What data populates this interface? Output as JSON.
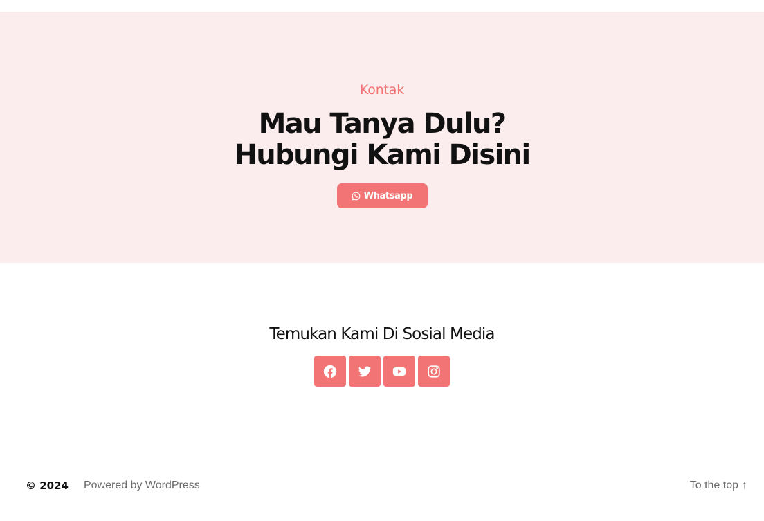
{
  "contact": {
    "eyebrow": "Kontak",
    "headline_line1": "Mau Tanya Dulu?",
    "headline_line2": "Hubungi Kami Disini",
    "whatsapp_label": "Whatsapp"
  },
  "social": {
    "title": "Temukan Kami Di Sosial Media",
    "items": [
      {
        "name": "facebook",
        "icon": "facebook-icon"
      },
      {
        "name": "twitter",
        "icon": "twitter-icon"
      },
      {
        "name": "youtube",
        "icon": "youtube-icon"
      },
      {
        "name": "instagram",
        "icon": "instagram-icon"
      }
    ]
  },
  "footer": {
    "copyright": "© 2024",
    "powered_by": "Powered by WordPress",
    "to_top": "To the top",
    "to_top_arrow": "↑"
  },
  "colors": {
    "accent": "#f27474",
    "contact_background": "#fbeced",
    "text": "#111111",
    "muted_text": "#6b6b6b"
  }
}
